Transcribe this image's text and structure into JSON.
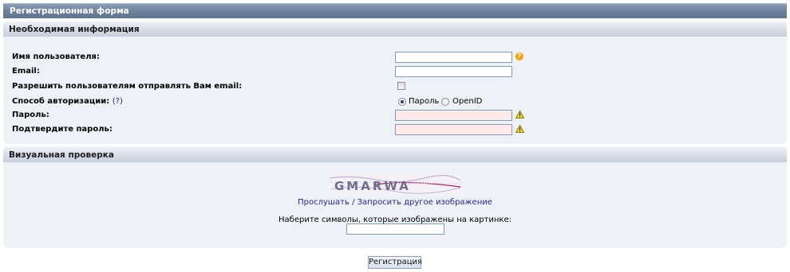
{
  "form": {
    "title": "Регистрационная форма"
  },
  "required_section": {
    "heading": "Необходимая информация",
    "username_label": "Имя пользователя:",
    "username_value": "",
    "email_label": "Email:",
    "email_value": "",
    "allow_email_label": "Разрешить пользователям отправлять Вам email:",
    "allow_email_checked": false,
    "auth_label": "Способ авторизации:",
    "auth_help": "(?)",
    "auth_options": [
      "Пароль",
      "OpenID"
    ],
    "auth_selected": "Пароль",
    "password_label": "Пароль:",
    "confirm_password_label": "Подтвердите пароль:",
    "help_icon": "question-icon",
    "warning_icon": "warning-icon"
  },
  "visual_section": {
    "heading": "Визуальная проверка",
    "captcha_text": "GMARWA",
    "listen_link": "Прослушать",
    "separator": "/",
    "new_image_link": "Запросить другое изображение",
    "prompt": "Наберите символы, которые изображены на картинке:",
    "input_value": ""
  },
  "submit_label": "Регистрация",
  "colors": {
    "title_bar": "#6d809b",
    "section_bg": "#eef2f6",
    "password_bg": "#ffe9e9",
    "link": "#22229c",
    "help_icon": "#f5a200"
  }
}
